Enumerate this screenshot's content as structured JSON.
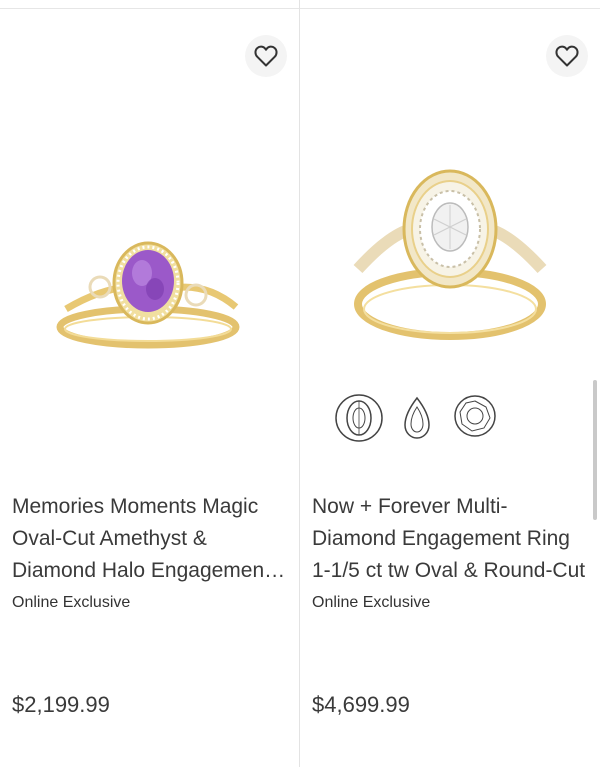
{
  "products": [
    {
      "title": "Memories Moments Magic Oval-Cut Amethyst & Diamond Halo Engagement Ring",
      "badge": "Online Exclusive",
      "price": "$2,199.99",
      "wishlist_icon": "heart-outline-icon",
      "gem_color": "#9b59c9"
    },
    {
      "title": "Now + Forever Multi-Diamond Engagement Ring 1-1/5 ct tw Oval & Round-Cut",
      "badge": "Online Exclusive",
      "price": "$4,699.99",
      "wishlist_icon": "heart-outline-icon",
      "swatches": [
        "oval-shape-icon",
        "pear-shape-icon",
        "round-shape-icon"
      ]
    }
  ],
  "colors": {
    "gold": "#e8c873",
    "divider": "#e3e3e3",
    "text": "#3a3a3a"
  }
}
